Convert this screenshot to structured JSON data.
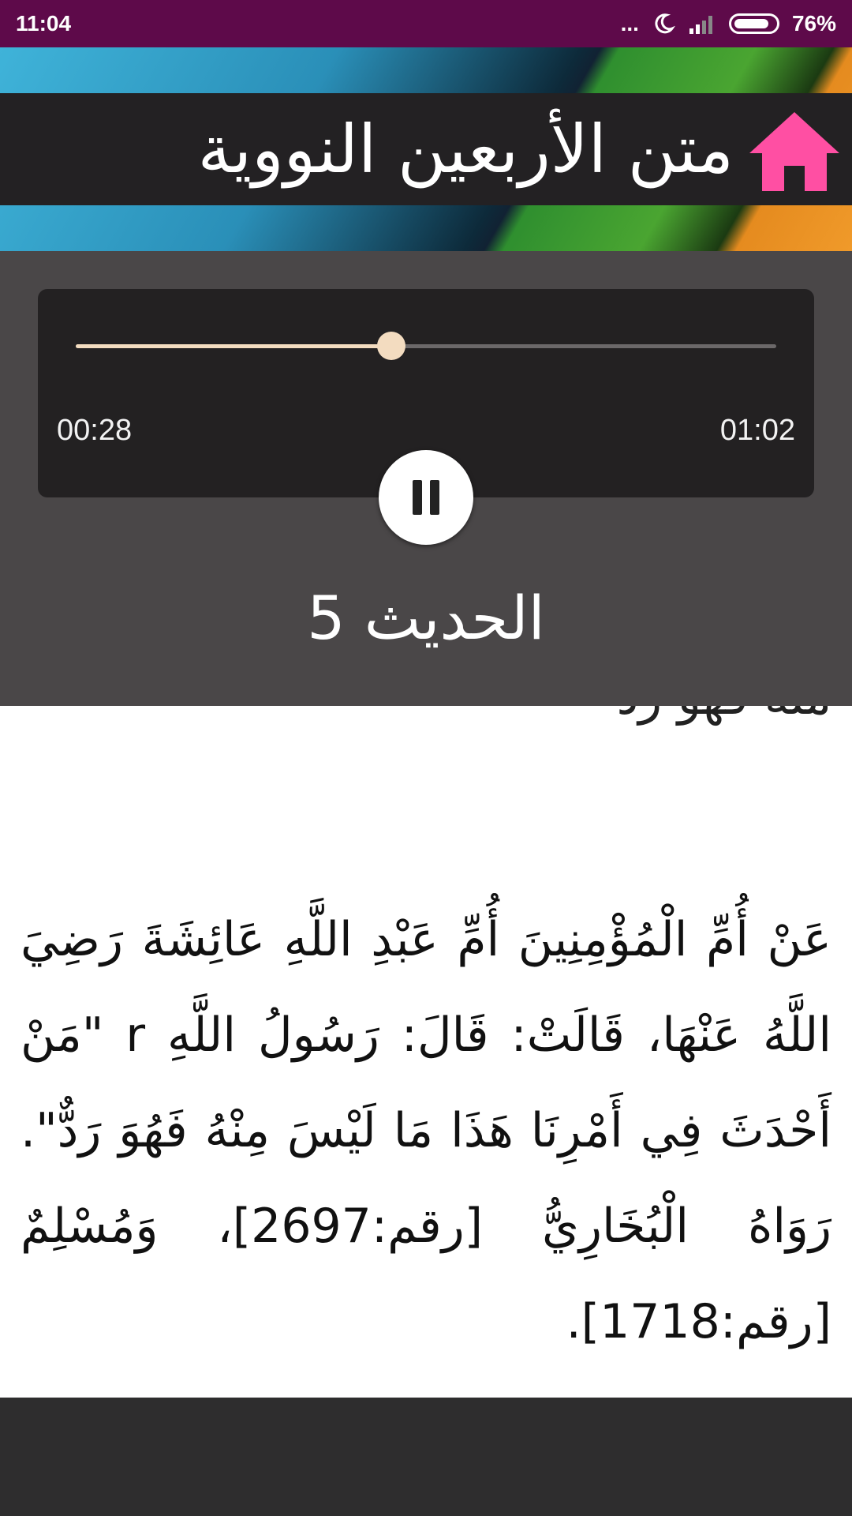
{
  "status_bar": {
    "time": "11:04",
    "dots": "...",
    "battery_percent": "76%",
    "icons": [
      "more-dots-icon",
      "moon-icon",
      "signal-icon",
      "battery-icon"
    ]
  },
  "header": {
    "title": "متن الأربعين النووية",
    "home_icon_color": "#ff4fa3"
  },
  "player": {
    "elapsed": "00:28",
    "total": "01:02",
    "progress": 0.45,
    "state": "playing",
    "track_title": "الحديث 5"
  },
  "content": {
    "previous_tail": "منه فهو رد",
    "hadith": "عَنْ أُمِّ الْمُؤْمِنِينَ أُمِّ عَبْدِ اللَّهِ عَائِشَةَ رَضِيَ اللَّهُ عَنْهَا، قَالَتْ: قَالَ: رَسُولُ اللَّهِ r \"مَنْ أَحْدَثَ فِي أَمْرِنَا هَذَا مَا لَيْسَ مِنْهُ فَهُوَ رَدٌّ\". رَوَاهُ الْبُخَارِيُّ [رقم:2697]، وَمُسْلِمٌ [رقم:1718]."
  },
  "colors": {
    "status_bar": "#5e0a4a",
    "title_bar": "#232123",
    "player_panel": "#4a4748",
    "player_card": "#232122",
    "seek_accent": "#f3dcc0",
    "bottom_bar": "#2e2d2e"
  }
}
